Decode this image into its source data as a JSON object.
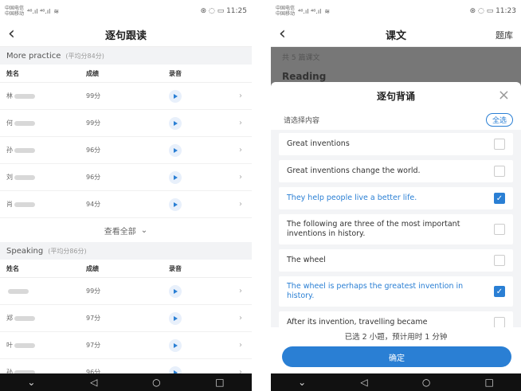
{
  "left": {
    "status": {
      "carrier1": "中国电信",
      "carrier2": "中国移动",
      "signal": "⁴⁶.ıl ⁴⁶.ıl",
      "time": "11:25"
    },
    "nav": {
      "title": "逐句跟读"
    },
    "sections": [
      {
        "name": "More practice",
        "avg": "(平均分84分)",
        "columns": [
          "姓名",
          "成绩",
          "录音"
        ],
        "rows": [
          {
            "name": "林",
            "score": "99分"
          },
          {
            "name": "何",
            "score": "99分"
          },
          {
            "name": "孙",
            "score": "96分"
          },
          {
            "name": "刘",
            "score": "96分"
          },
          {
            "name": "肖",
            "score": "94分"
          }
        ],
        "view_all": "查看全部"
      },
      {
        "name": "Speaking",
        "avg": "(平均分86分)",
        "columns": [
          "姓名",
          "成绩",
          "录音"
        ],
        "rows": [
          {
            "name": "",
            "score": "99分"
          },
          {
            "name": "郑",
            "score": "97分"
          },
          {
            "name": "叶",
            "score": "97分"
          },
          {
            "name": "孙",
            "score": "96分"
          }
        ]
      }
    ]
  },
  "right": {
    "status": {
      "carrier1": "中国电信",
      "carrier2": "中国移动",
      "signal": "⁴⁶.ıl ⁴⁶.ıl",
      "time": "11:23"
    },
    "nav": {
      "title": "课文",
      "right": "题库"
    },
    "bg": {
      "line1": "共 5 篇课文",
      "line2": "Reading"
    },
    "sheet": {
      "title": "逐句背诵",
      "choose_label": "请选择内容",
      "select_all": "全选",
      "items": [
        {
          "text": "Great inventions",
          "checked": false
        },
        {
          "text": "Great inventions change the world.",
          "checked": false
        },
        {
          "text": "They help people live a better life.",
          "checked": true
        },
        {
          "text": "The following are three of the most important inventions in history.",
          "checked": false
        },
        {
          "text": "The wheel",
          "checked": false
        },
        {
          "text": "The wheel is perhaps the greatest invention in history.",
          "checked": true
        },
        {
          "text": "After its invention, travelling became",
          "checked": false
        }
      ],
      "summary": "已选 2 小题，预计用时 1 分钟",
      "confirm": "确定"
    }
  }
}
